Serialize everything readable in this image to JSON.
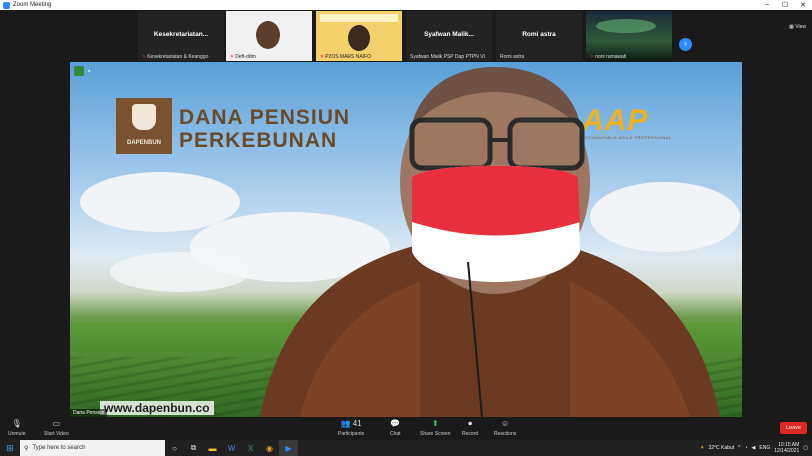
{
  "window": {
    "title": "Zoom Meeting"
  },
  "strip": {
    "tiles": [
      {
        "name": "Kesekretariatan...",
        "caption": "Kesekretariatan & Keanggo"
      },
      {
        "name": "",
        "caption": "Deft-ddm"
      },
      {
        "name": "",
        "caption": "P2OS MARS NAIFO"
      },
      {
        "name": "Syafwan  Malik...",
        "caption": "Syafwan Malik PSP Dap PTPN VI"
      },
      {
        "name": "Romi astra",
        "caption": "Romi astra"
      },
      {
        "name": "",
        "caption": "noni ramawati"
      }
    ],
    "next_icon": "chevron-right-icon",
    "view_label": "View"
  },
  "main": {
    "logo_name_line1": "DANA PENSIUN",
    "logo_name_line2": "PERKEBUNAN",
    "logo_box_text": "DAPENBUN",
    "aap_logo": "AAP",
    "aap_sub": "ACCOUNTABLE AGILE PROFESSIONAL",
    "url": "www.dapenbun.co",
    "nameplate": "Dana Pensiun"
  },
  "toolbar": {
    "unmute": "Unmute",
    "start_video": "Start Video",
    "participants": "Participants",
    "participants_count": "41",
    "chat": "Chat",
    "share_screen": "Share Screen",
    "record": "Record",
    "reactions": "Reactions",
    "leave": "Leave"
  },
  "taskbar": {
    "search_placeholder": "Type here to search",
    "weather": "32°C  Kabut",
    "lang": "ENG",
    "time": "10:15 AM",
    "date": "12/14/2021"
  },
  "colors": {
    "accent": "#2d8cff",
    "leave": "#e02828",
    "brand_brown": "#7a5230",
    "aap_yellow": "#f2b21e"
  }
}
